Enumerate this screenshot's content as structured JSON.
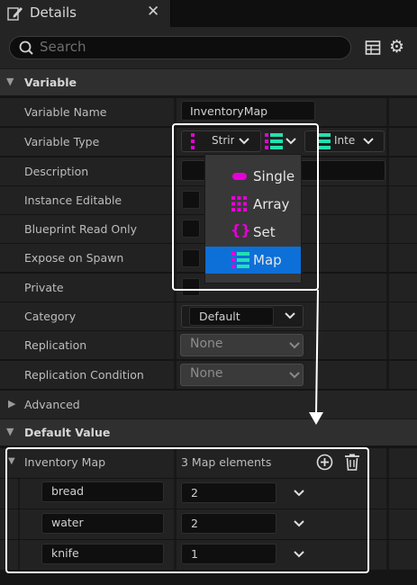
{
  "tab": {
    "title": "Details",
    "close_glyph": "✕",
    "icon": "edit-pencil-icon"
  },
  "search": {
    "placeholder": "Search"
  },
  "toolbar": {
    "table_icon": "table-view-icon",
    "settings_icon": "gear-icon"
  },
  "sections": {
    "variable": "Variable",
    "advanced": "Advanced",
    "default_value": "Default Value"
  },
  "properties": {
    "variable_name": {
      "label": "Variable Name",
      "value": "InventoryMap"
    },
    "variable_type": {
      "label": "Variable Type",
      "key_type": "Strin",
      "value_type": "Inte"
    },
    "description": {
      "label": "Description",
      "value": ""
    },
    "instance_editable": {
      "label": "Instance Editable"
    },
    "blueprint_read_only": {
      "label": "Blueprint Read Only"
    },
    "expose_on_spawn": {
      "label": "Expose on Spawn"
    },
    "private": {
      "label": "Private"
    },
    "category": {
      "label": "Category",
      "value": "Default"
    },
    "replication": {
      "label": "Replication",
      "value": "None"
    },
    "replication_condition": {
      "label": "Replication Condition",
      "value": "None"
    }
  },
  "container_menu": {
    "items": [
      {
        "label": "Single",
        "icon": "single-pill-icon"
      },
      {
        "label": "Array",
        "icon": "array-grid-icon"
      },
      {
        "label": "Set",
        "icon": "set-braces-icon"
      },
      {
        "label": "Map",
        "icon": "map-icon"
      }
    ],
    "selected": "Map"
  },
  "default_value": {
    "label": "Inventory Map",
    "count_text": "3 Map elements",
    "entries": [
      {
        "key": "bread",
        "value": "2"
      },
      {
        "key": "water",
        "value": "2"
      },
      {
        "key": "knife",
        "value": "1"
      }
    ]
  },
  "colors": {
    "accent_selected": "#0c70d8",
    "string_pin": "#e600d6",
    "integer_pin": "#22e0b0",
    "highlight": "#ffffff"
  }
}
